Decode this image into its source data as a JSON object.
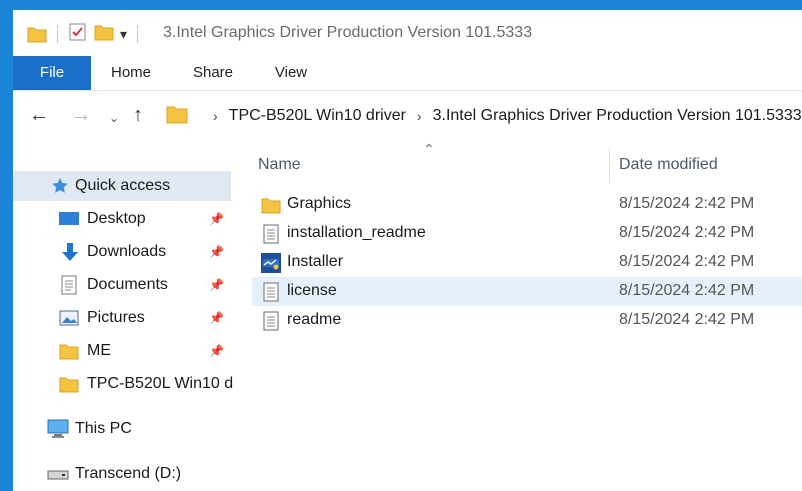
{
  "window": {
    "title": "3.Intel Graphics Driver Production Version 101.5333",
    "qat_dropdown_glyph": "▾"
  },
  "ribbon": {
    "tabs": [
      "File",
      "Home",
      "Share",
      "View"
    ]
  },
  "address": {
    "crumbs": [
      "TPC-B520L Win10 driver",
      "3.Intel Graphics Driver Production Version 101.5333"
    ]
  },
  "nav": {
    "items": [
      {
        "label": "Quick access",
        "icon": "star-icon",
        "pinned": false
      },
      {
        "label": "Desktop",
        "icon": "desktop-icon",
        "pinned": true
      },
      {
        "label": "Downloads",
        "icon": "download-icon",
        "pinned": true
      },
      {
        "label": "Documents",
        "icon": "document-icon",
        "pinned": true
      },
      {
        "label": "Pictures",
        "icon": "pictures-icon",
        "pinned": true
      },
      {
        "label": "ME",
        "icon": "folder-icon",
        "pinned": true
      },
      {
        "label": "TPC-B520L Win10 d",
        "icon": "folder-icon",
        "pinned": false
      },
      {
        "label": "This PC",
        "icon": "computer-icon",
        "pinned": false
      },
      {
        "label": "Transcend (D:)",
        "icon": "drive-icon",
        "pinned": false
      }
    ]
  },
  "content": {
    "columns": {
      "name": "Name",
      "date": "Date modified"
    },
    "rows": [
      {
        "name": "Graphics",
        "date": "8/15/2024 2:42 PM",
        "icon": "folder-icon"
      },
      {
        "name": "installation_readme",
        "date": "8/15/2024 2:42 PM",
        "icon": "text-file-icon"
      },
      {
        "name": "Installer",
        "date": "8/15/2024 2:42 PM",
        "icon": "intel-installer-icon"
      },
      {
        "name": "license",
        "date": "8/15/2024 2:42 PM",
        "icon": "text-file-icon"
      },
      {
        "name": "readme",
        "date": "8/15/2024 2:42 PM",
        "icon": "text-file-icon"
      }
    ],
    "selected_row": "license"
  },
  "colors": {
    "accent": "#1b86d8",
    "file_tab": "#1b6fc9",
    "folder": "#f5c342",
    "selection": "#e5f0fb",
    "nav_selection": "#dfe8f3"
  }
}
